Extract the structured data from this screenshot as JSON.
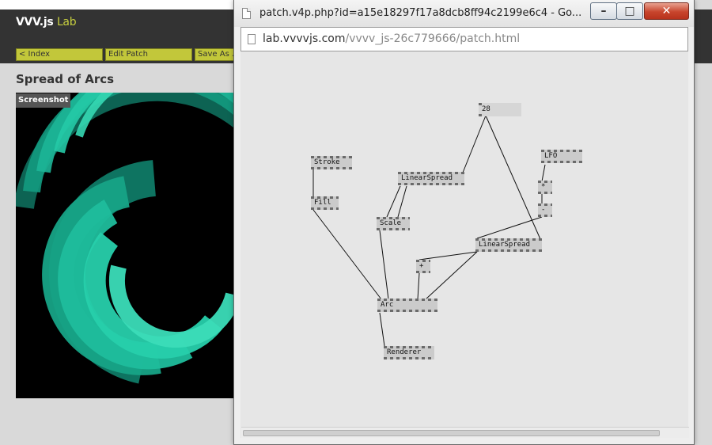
{
  "lab": {
    "logo_main": "VVV.js",
    "logo_accent": "Lab",
    "nav": {
      "index": "< Index",
      "edit_patch": "Edit Patch",
      "save_as": "Save As ..."
    },
    "page_title": "Spread of Arcs",
    "screenshot_label": "Screenshot"
  },
  "popup": {
    "window_title": "patch.v4p.php?id=a15e18297f17a8dcb8ff94c2199e6c4 - Go...",
    "controls": {
      "minimize": "–",
      "maximize": "□",
      "close": "✕"
    },
    "url": {
      "host": "lab.vvvvjs.com",
      "path": "/vvvv_js-26c779666/patch.html"
    }
  },
  "patch": {
    "nodes": {
      "value_28": "28",
      "stroke": "Stroke",
      "fill": "Fill",
      "linearspread_1": "LinearSpread",
      "lfo": "LFO",
      "multiply": "*",
      "minus": "-",
      "scale": "Scale",
      "linearspread_2": "LinearSpread",
      "plus": "+",
      "arc": "Arc",
      "renderer": "Renderer"
    }
  }
}
